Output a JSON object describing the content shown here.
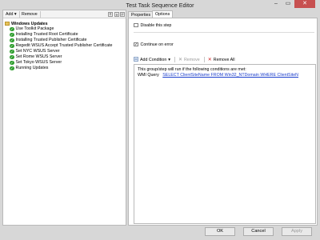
{
  "window": {
    "title": "Test Task Sequence Editor",
    "min_symbol": "–",
    "max_symbol": "▭",
    "close_symbol": "✕"
  },
  "left_toolbar": {
    "add_label": "Add",
    "add_arrow": "▾",
    "remove_label": "Remove",
    "icons": [
      "up-icon",
      "down-icon",
      "properties-icon"
    ]
  },
  "tree": {
    "group_label": "Windows Updates",
    "items": [
      {
        "label": "Use Toolkit Package"
      },
      {
        "label": "Installing Trusted Root Certificate"
      },
      {
        "label": "Installing Trusted Publisher Certificate"
      },
      {
        "label": "Regedit WSUS Accept Trusted Publisher Certificate"
      },
      {
        "label": "Set NYC WSUS Server"
      },
      {
        "label": "Set Rome WSUS Server"
      },
      {
        "label": "Set Tokyo WSUS Server"
      },
      {
        "label": "Running Updates"
      }
    ]
  },
  "tabs": [
    {
      "label": "Properties"
    },
    {
      "label": "Options"
    }
  ],
  "options": {
    "disable_step_label": "Disable this step",
    "disable_step_checked": false,
    "continue_on_error_label": "Continue on error",
    "continue_on_error_checked": true,
    "check_mark": "✓",
    "cond_toolbar": {
      "add_condition_label": "Add Condition",
      "add_condition_arrow": "▾",
      "remove_label": "Remove",
      "remove_all_label": "Remove All"
    },
    "conditions_header": "This group/step will run if the following conditions are met:",
    "wmi_label": "WMI Query",
    "wmi_query": "SELECT ClientSiteName FROM Win32_NTDomain WHERE ClientSiteN"
  },
  "buttons": {
    "ok": "OK",
    "cancel": "Cancel",
    "apply": "Apply"
  },
  "colors": {
    "accent_close": "#c75050",
    "check_green": "#2f9e2f",
    "link_blue": "#1a3dcc",
    "remove_all_red": "#d11f1f"
  }
}
